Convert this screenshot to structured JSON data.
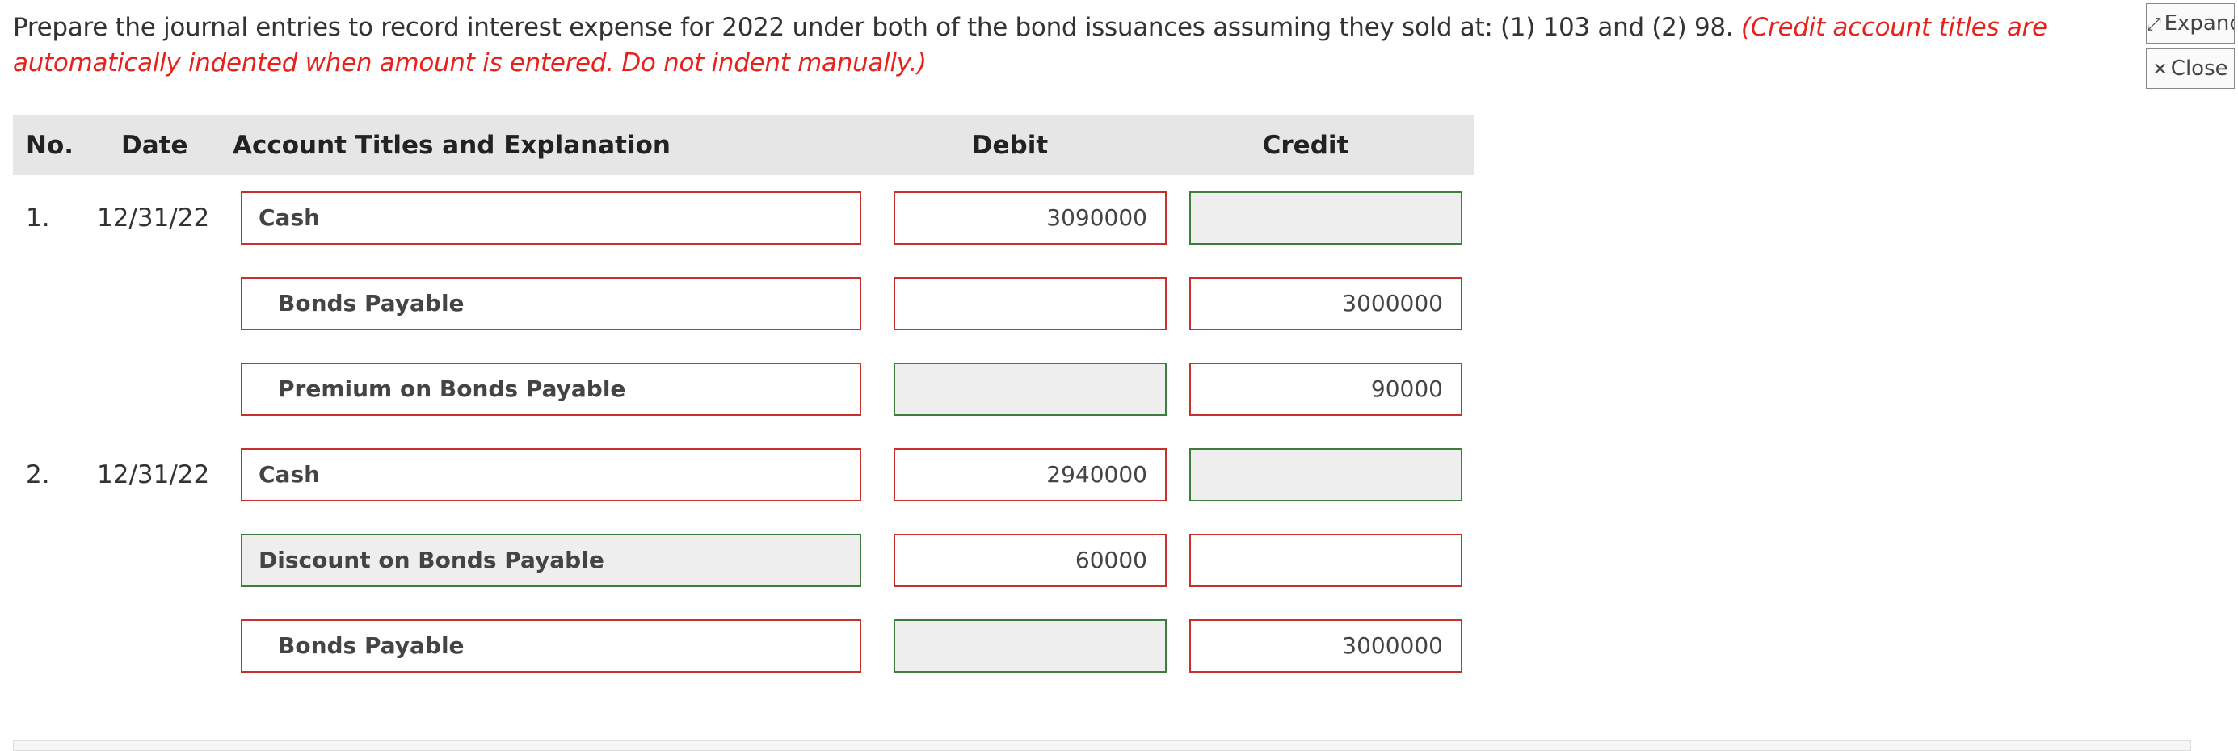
{
  "instructions": {
    "text": "Prepare the journal entries to record interest expense for 2022 under both of the bond issuances assuming they sold at: (1) 103 and (2) 98.",
    "note": "(Credit account titles are automatically indented when amount is entered. Do not indent manually.)"
  },
  "tools": {
    "expand_label": "Expand",
    "close_label": "Close"
  },
  "table": {
    "headers": {
      "no": "No.",
      "date": "Date",
      "account": "Account Titles and Explanation",
      "debit": "Debit",
      "credit": "Credit"
    }
  },
  "entries": [
    {
      "no": "1.",
      "date": "12/31/22",
      "lines": [
        {
          "account": "Cash",
          "debit": "3090000",
          "credit": ""
        },
        {
          "account": "Bonds Payable",
          "debit": "",
          "credit": "3000000"
        },
        {
          "account": "Premium on Bonds Payable",
          "debit": "",
          "credit": "90000"
        }
      ]
    },
    {
      "no": "2.",
      "date": "12/31/22",
      "lines": [
        {
          "account": "Cash",
          "debit": "2940000",
          "credit": ""
        },
        {
          "account": "Discount on Bonds Payable",
          "debit": "60000",
          "credit": ""
        },
        {
          "account": "Bonds Payable",
          "debit": "",
          "credit": "3000000"
        }
      ]
    }
  ]
}
